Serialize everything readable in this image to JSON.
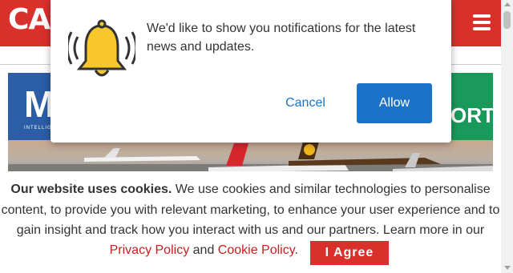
{
  "header": {
    "logo_text": "CA",
    "menu_icon": "hamburger-menu-icon",
    "background_color": "#d9302c"
  },
  "banner": {
    "left_logo_text": "M",
    "left_sub_text": "INTELLIGENT JOURNEY",
    "right_logo_text": "ORT",
    "tail_logo": "ups"
  },
  "notification": {
    "icon": "bell-icon",
    "message": "We'd like to show you notifications for the latest news and updates.",
    "cancel_label": "Cancel",
    "allow_label": "Allow",
    "accent_color": "#1a73c9"
  },
  "cookie": {
    "title": "Our website uses cookies.",
    "body": " We use cookies and similar technologies to personalise content, to provide you with relevant marketing, to enhance your user experience and to gain insight and track how you interact with us and our partners. Learn more in our",
    "privacy_label": "Privacy Policy",
    "and_text": "and",
    "cookie_policy_label": "Cookie Policy",
    "period": ".",
    "agree_label": "I Agree",
    "accent_color": "#c8201d"
  }
}
